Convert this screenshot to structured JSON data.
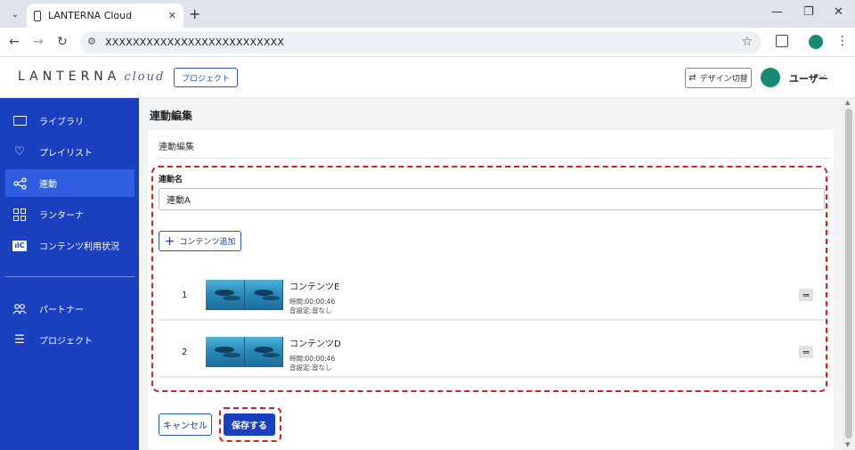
{
  "browser": {
    "tab_title": "LANTERNA Cloud",
    "tab_close": "✕",
    "new_tab": "+",
    "url": "XXXXXXXXXXXXXXXXXXXXXXXXXX",
    "window_controls": {
      "minimize": "—",
      "restore": "❐",
      "close": "✕"
    }
  },
  "header": {
    "logo_text": "LANTERNA",
    "logo_cloud": "cloud",
    "project_button": "プロジェクト",
    "design_switch": "デザイン切替",
    "user_name": "ユーザー"
  },
  "sidebar": {
    "items": [
      {
        "label": "ライブラリ",
        "icon": "folder-icon"
      },
      {
        "label": "プレイリスト",
        "icon": "heart-icon"
      },
      {
        "label": "連動",
        "icon": "share-icon",
        "active": true
      },
      {
        "label": "ランターナ",
        "icon": "grid-icon"
      },
      {
        "label": "コンテンツ利用状況",
        "icon": "usage-icon"
      },
      {
        "label": "パートナー",
        "icon": "partners-icon"
      },
      {
        "label": "プロジェクト",
        "icon": "list-icon"
      }
    ]
  },
  "main": {
    "page_title": "連動編集",
    "card_title": "連動編集",
    "name_label": "連動名",
    "name_value": "連動A",
    "add_content_button": "コンテンツ追加",
    "contents": [
      {
        "index": "1",
        "name": "コンテンツE",
        "duration": "時間:00:00:46",
        "sound": "音設定:音なし"
      },
      {
        "index": "2",
        "name": "コンテンツD",
        "duration": "時間:00:00:46",
        "sound": "音設定:音なし"
      }
    ],
    "cancel_button": "キャンセル",
    "save_button": "保存する"
  },
  "colors": {
    "sidebar_bg": "#1a3fbf",
    "sidebar_active": "#2f5fe0",
    "accent": "#2a56c6",
    "highlight_dash": "#e01b1b",
    "avatar": "#168a73"
  }
}
